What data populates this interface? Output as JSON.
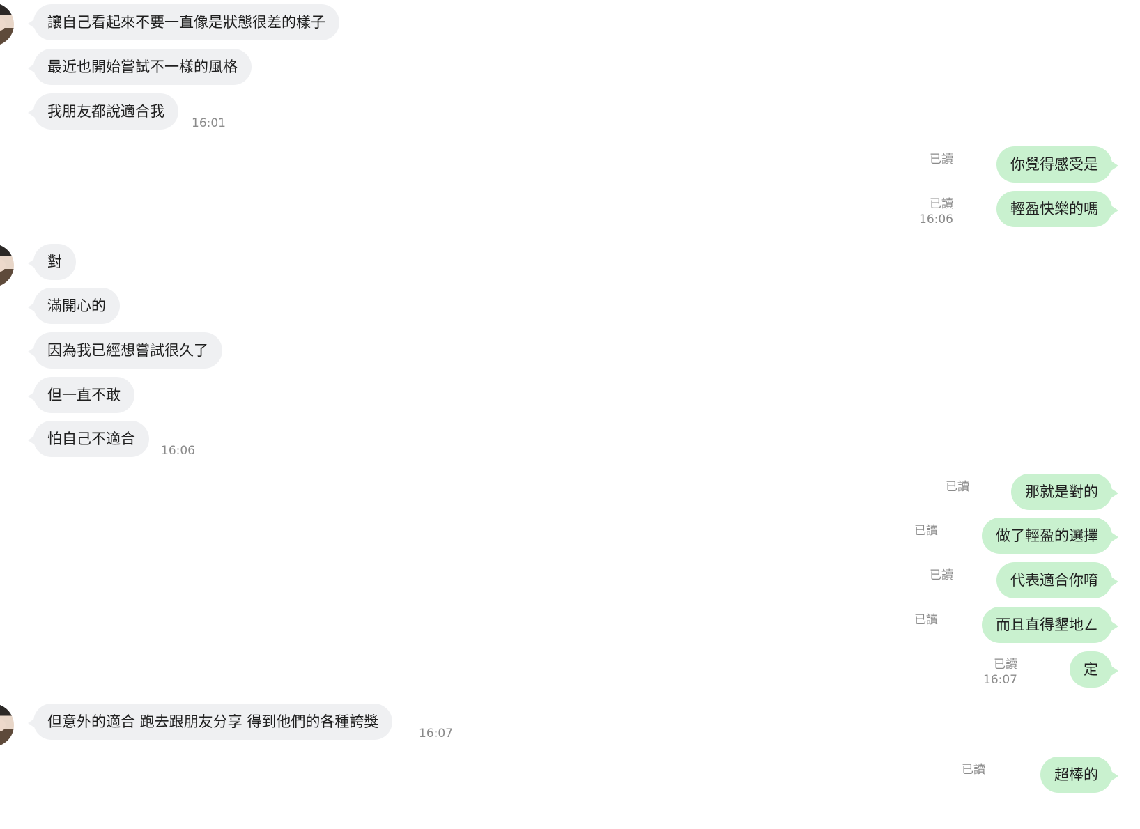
{
  "chat": {
    "read_label": "已讀",
    "messages": [
      {
        "dir": "in",
        "text": "讓自己看起來不要一直像是狀態很差的樣子",
        "time": ""
      },
      {
        "dir": "in",
        "text": "最近也開始嘗試不一樣的風格",
        "time": ""
      },
      {
        "dir": "in",
        "text": "我朋友都說適合我",
        "time": "16:01"
      },
      {
        "dir": "out",
        "text": "你覺得感受是",
        "time": ""
      },
      {
        "dir": "out",
        "text": "輕盈快樂的嗎",
        "time": "16:06"
      },
      {
        "dir": "in",
        "text": "對",
        "time": ""
      },
      {
        "dir": "in",
        "text": "滿開心的",
        "time": ""
      },
      {
        "dir": "in",
        "text": "因為我已經想嘗試很久了",
        "time": ""
      },
      {
        "dir": "in",
        "text": "但一直不敢",
        "time": ""
      },
      {
        "dir": "in",
        "text": "怕自己不適合",
        "time": "16:06"
      },
      {
        "dir": "out",
        "text": "那就是對的",
        "time": ""
      },
      {
        "dir": "out",
        "text": "做了輕盈的選擇",
        "time": ""
      },
      {
        "dir": "out",
        "text": "代表適合你唷",
        "time": ""
      },
      {
        "dir": "out",
        "text": "而且直得墾地ㄥ",
        "time": ""
      },
      {
        "dir": "out",
        "text": "定",
        "time": "16:07"
      },
      {
        "dir": "in",
        "text": "但意外的適合 跑去跟朋友分享 得到他們的各種誇獎",
        "time": "16:07"
      },
      {
        "dir": "out",
        "text": "超棒的",
        "time": ""
      }
    ]
  }
}
